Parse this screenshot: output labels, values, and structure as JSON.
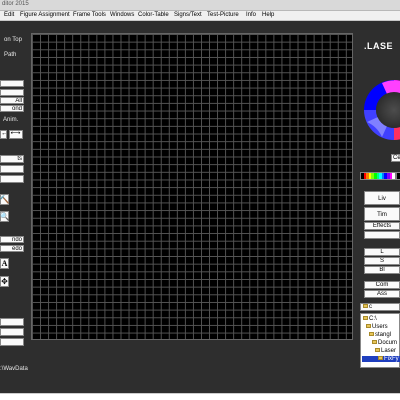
{
  "window": {
    "title": "ditor 2015"
  },
  "menu": [
    "Edit",
    "Figure Assignment",
    "Frame Tools",
    "Windows",
    "Color-Table",
    "Signs/Text",
    "Test-Picture",
    "Info",
    "Help"
  ],
  "left_panel": {
    "on_top": "on Top",
    "path": "Path",
    "btn_all": "All",
    "btn_ond": "ond",
    "anim": "Anim.",
    "ts": "ts",
    "undo": "ndo",
    "redo": "edo",
    "wavdata": ":\\WavData"
  },
  "right_panel": {
    "logo": ".LASE",
    "center_label": "Ce",
    "buttons": [
      "Liv",
      "Tim",
      "Effects",
      "L",
      "S",
      "Bl",
      "Com",
      "Ass"
    ],
    "drive": "c",
    "tree": [
      "C:\\",
      "Users",
      "stangl",
      "Docum",
      "Laser",
      "FixFy"
    ],
    "palette": [
      "#000000",
      "#ff0000",
      "#ff8000",
      "#ffff00",
      "#80ff00",
      "#00ff00",
      "#00ff80",
      "#00ffff",
      "#0080ff",
      "#0000ff",
      "#8000ff",
      "#ff00ff",
      "#ffffff",
      "#808080",
      "#000000"
    ]
  }
}
